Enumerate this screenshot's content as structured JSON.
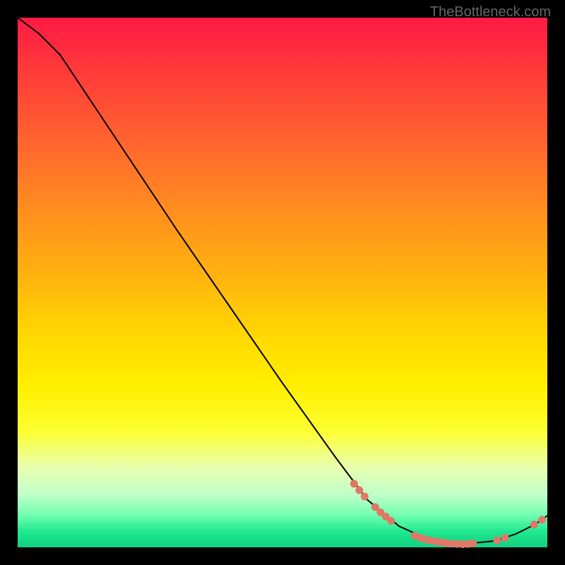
{
  "watermark": "TheBottleneck.com",
  "chart_data": {
    "type": "line",
    "title": "",
    "xlabel": "",
    "ylabel": "",
    "xlim": [
      0,
      100
    ],
    "ylim": [
      0,
      100
    ],
    "curve": [
      {
        "x": 0,
        "y": 100
      },
      {
        "x": 4,
        "y": 97
      },
      {
        "x": 8,
        "y": 93
      },
      {
        "x": 12,
        "y": 87
      },
      {
        "x": 20,
        "y": 75
      },
      {
        "x": 30,
        "y": 60
      },
      {
        "x": 40,
        "y": 45.5
      },
      {
        "x": 50,
        "y": 31
      },
      {
        "x": 60,
        "y": 17
      },
      {
        "x": 66,
        "y": 9
      },
      {
        "x": 72,
        "y": 4
      },
      {
        "x": 78,
        "y": 1.3
      },
      {
        "x": 84,
        "y": 0.6
      },
      {
        "x": 90,
        "y": 1.2
      },
      {
        "x": 94,
        "y": 2.5
      },
      {
        "x": 97,
        "y": 4.0
      },
      {
        "x": 99,
        "y": 5.2
      },
      {
        "x": 100,
        "y": 6.0
      }
    ],
    "markers": [
      {
        "x": 63.5,
        "y": 12.0
      },
      {
        "x": 64.5,
        "y": 10.8
      },
      {
        "x": 65.5,
        "y": 9.6
      },
      {
        "x": 67.5,
        "y": 7.6
      },
      {
        "x": 68.5,
        "y": 6.6
      },
      {
        "x": 69.5,
        "y": 5.8
      },
      {
        "x": 70.5,
        "y": 5.0
      },
      {
        "x": 75.0,
        "y": 2.2
      },
      {
        "x": 76.0,
        "y": 1.8
      },
      {
        "x": 77.0,
        "y": 1.5
      },
      {
        "x": 78.0,
        "y": 1.3
      },
      {
        "x": 79.0,
        "y": 1.1
      },
      {
        "x": 80.0,
        "y": 0.95
      },
      {
        "x": 81.0,
        "y": 0.8
      },
      {
        "x": 82.0,
        "y": 0.7
      },
      {
        "x": 83.0,
        "y": 0.65
      },
      {
        "x": 84.0,
        "y": 0.6
      },
      {
        "x": 85.0,
        "y": 0.65
      },
      {
        "x": 86.0,
        "y": 0.75
      },
      {
        "x": 90.5,
        "y": 1.3
      },
      {
        "x": 92.0,
        "y": 1.8
      },
      {
        "x": 97.5,
        "y": 4.3
      },
      {
        "x": 99.0,
        "y": 5.2
      }
    ],
    "marker_color": "#e07868",
    "line_color": "#000000"
  }
}
